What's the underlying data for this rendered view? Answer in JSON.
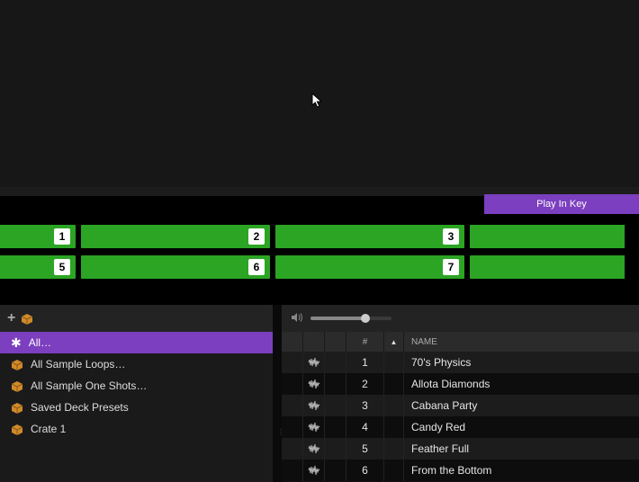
{
  "toolbar": {
    "play_in_key": "Play In Key"
  },
  "pads": {
    "row1": [
      "1",
      "2",
      "3",
      ""
    ],
    "row2": [
      "5",
      "6",
      "7",
      ""
    ]
  },
  "library": {
    "items": [
      {
        "icon": "star",
        "label": "All…",
        "selected": true
      },
      {
        "icon": "crate",
        "label": "All Sample Loops…",
        "selected": false
      },
      {
        "icon": "crate",
        "label": "All Sample One Shots…",
        "selected": false
      },
      {
        "icon": "crate",
        "label": "Saved Deck Presets",
        "selected": false
      },
      {
        "icon": "crate",
        "label": "Crate 1",
        "selected": false
      }
    ]
  },
  "browser": {
    "volume_pct": 68,
    "columns": {
      "num": "#",
      "name": "NAME"
    },
    "rows": [
      {
        "n": "1",
        "name": "70's Physics"
      },
      {
        "n": "2",
        "name": "Allota Diamonds"
      },
      {
        "n": "3",
        "name": "Cabana Party"
      },
      {
        "n": "4",
        "name": "Candy Red"
      },
      {
        "n": "5",
        "name": "Feather Full"
      },
      {
        "n": "6",
        "name": "From the Bottom"
      }
    ]
  }
}
